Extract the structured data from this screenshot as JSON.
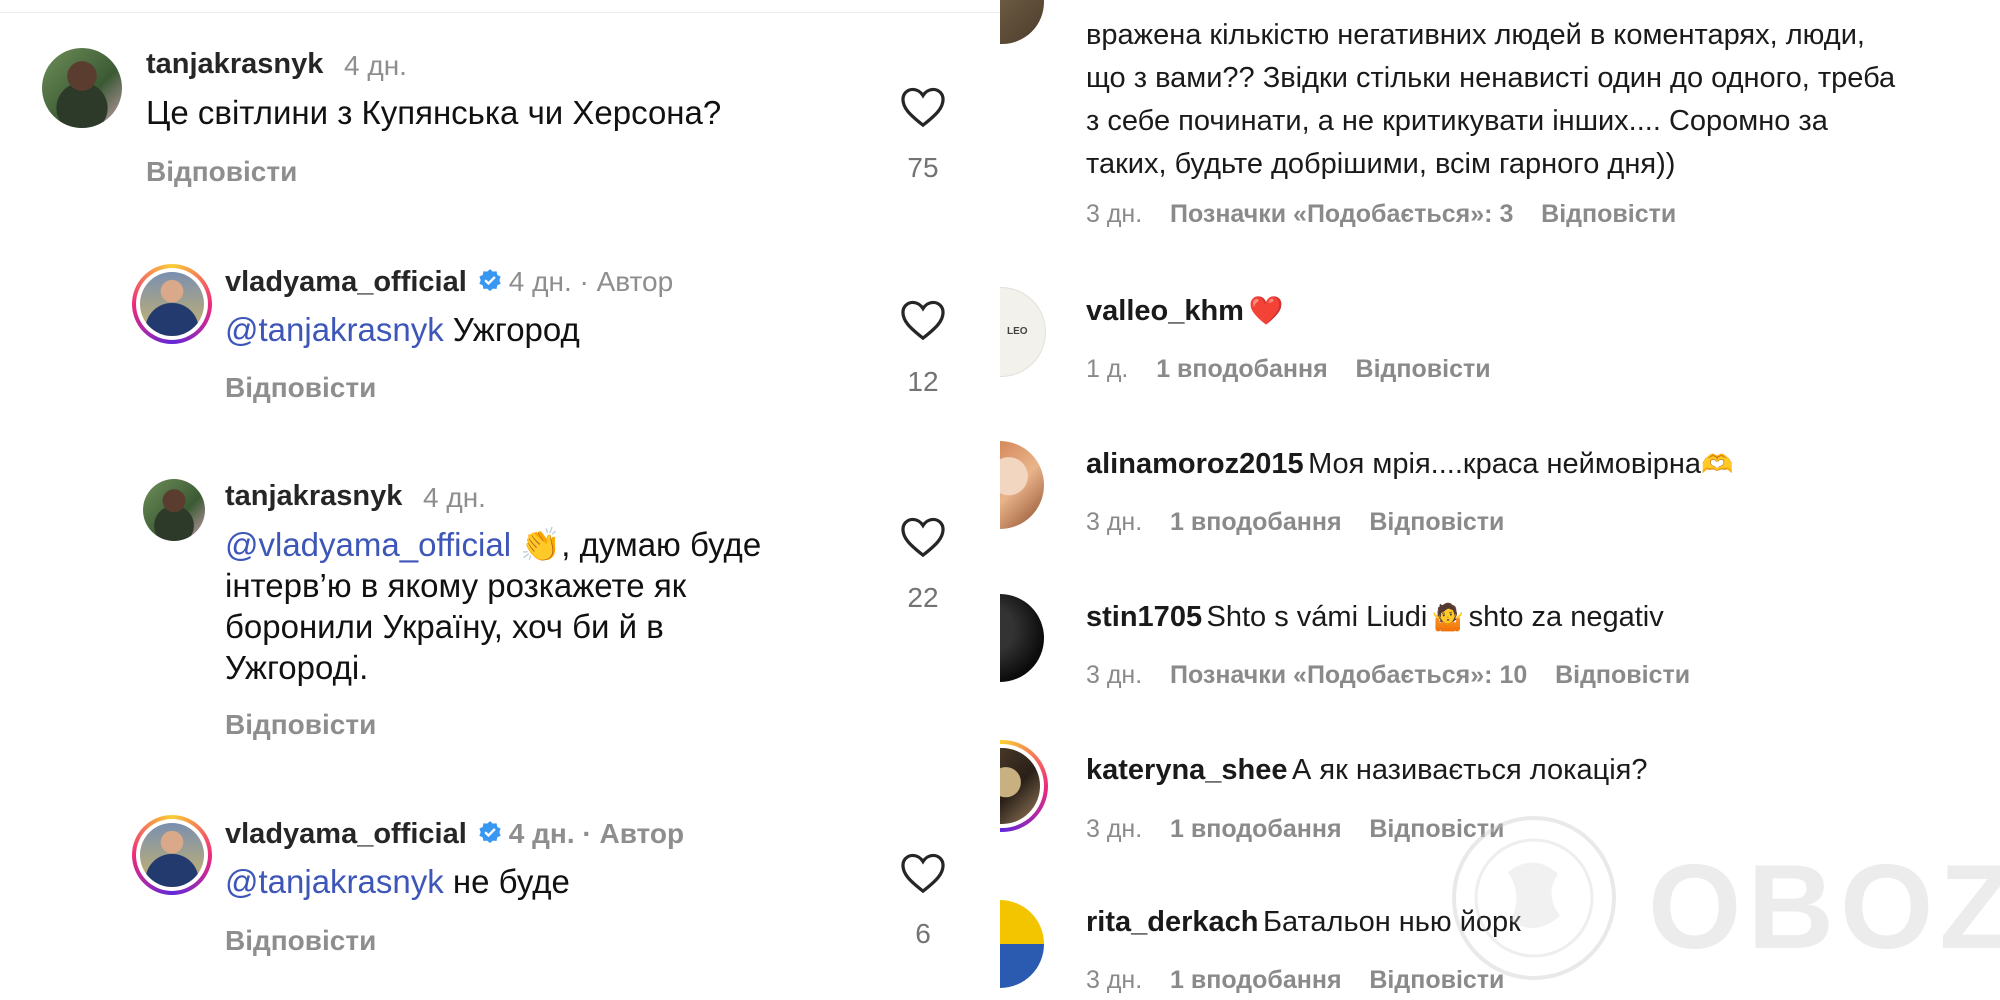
{
  "left": {
    "comments": [
      {
        "user": "tanjakrasnyk",
        "time": "4 дн.",
        "text": "Це світлини з Купянська чи Херсона?",
        "reply": "Відповісти",
        "likes": "75"
      },
      {
        "user": "vladyama_official",
        "time": "4 дн. · Автор",
        "mention": "@tanjakrasnyk",
        "text": " Ужгород",
        "reply": "Відповісти",
        "likes": "12"
      },
      {
        "user": "tanjakrasnyk",
        "time": "4 дн.",
        "mention": "@vladyama_official",
        "emoji": "👏",
        "text_line1": ", думаю буде",
        "text_line2": "інтерв’ю в якому розкажете як",
        "text_line3": "боронили Україну, хоч би й в",
        "text_line4": "Ужгороді.",
        "reply": "Відповісти",
        "likes": "22"
      },
      {
        "user": "vladyama_official",
        "time": "4 дн. · Автор",
        "mention": "@tanjakrasnyk",
        "text": " не буде",
        "reply": "Відповісти",
        "likes": "6"
      }
    ]
  },
  "right": {
    "first": {
      "line1": "вражена кількістю негативних людей в коментарях, люди,",
      "line2": "що з вами?? Звідки стільки ненависті один до одного, треба",
      "line3": "з себе починати, а не критикувати інших.... Соромно за",
      "line4": "таких, будьте добрішими, всім гарного дня))",
      "time": "3 дн.",
      "likes": "Позначки «Подобається»: 3",
      "reply": "Відповісти"
    },
    "comments": [
      {
        "user": "valleo_khm",
        "text": "",
        "emoji": "❤️",
        "time": "1 д.",
        "likes": "1 вподобання",
        "reply": "Відповісти"
      },
      {
        "user": "alinamoroz2015",
        "text": "Моя мрія....краса неймовірна",
        "emoji": "🫶",
        "time": "3 дн.",
        "likes": "1 вподобання",
        "reply": "Відповісти"
      },
      {
        "user": "stin1705",
        "text": "Shto s vámi Liudi",
        "emoji": "🤷",
        "text2": "shto za negativ",
        "time": "3 дн.",
        "likes": "Позначки «Подобається»: 10",
        "reply": "Відповісти"
      },
      {
        "user": "kateryna_shee",
        "text": "А як називається локація?",
        "time": "3 дн.",
        "likes": "1 вподобання",
        "reply": "Відповісти"
      },
      {
        "user": "rita_derkach",
        "text": "Батальон нью йорк",
        "time": "3 дн.",
        "likes": "1 вподобання",
        "reply": "Відповісти"
      }
    ],
    "avatar_logo": "LEO",
    "watermark": "OBOZ.UA"
  },
  "colors": {
    "mention": "#3d56b8",
    "heart_stroke": "#262626",
    "verified": "#3897f0",
    "emoji_heart": "#ed1c24"
  }
}
